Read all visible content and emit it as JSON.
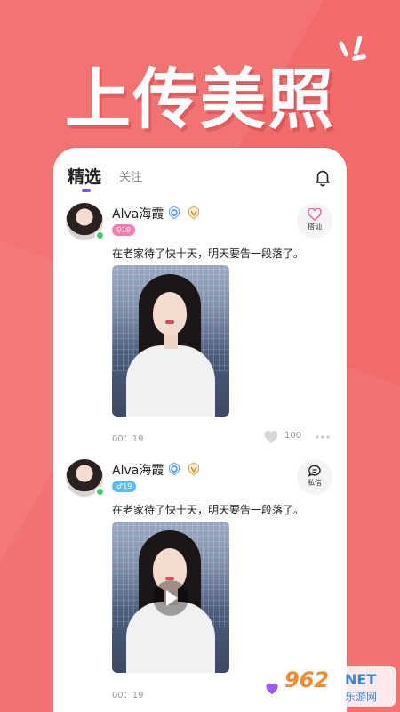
{
  "headline": "上传美照",
  "tabs": {
    "active": "精选",
    "inactive": "关注"
  },
  "posts": [
    {
      "username": "Alva海霞",
      "age_tag": "♀19",
      "action_label": "搭讪",
      "caption": "在老家待了快十天，明天要告一段落了。",
      "duration": "00：19",
      "like_count": "100",
      "is_video": false
    },
    {
      "username": "Alva海霞",
      "age_tag": "♂19",
      "action_label": "私信",
      "caption": "在老家待了快十天，明天要告一段落了。",
      "duration": "00：19",
      "is_video": true
    }
  ],
  "watermark": {
    "number": "962",
    "net": "NET",
    "sub": "乐游网"
  },
  "colors": {
    "background": "#f26a6a",
    "accent": "#7b55f5",
    "online": "#3ccf6c",
    "female_tag": "#f87cb0",
    "male_tag": "#5cbcf2"
  }
}
